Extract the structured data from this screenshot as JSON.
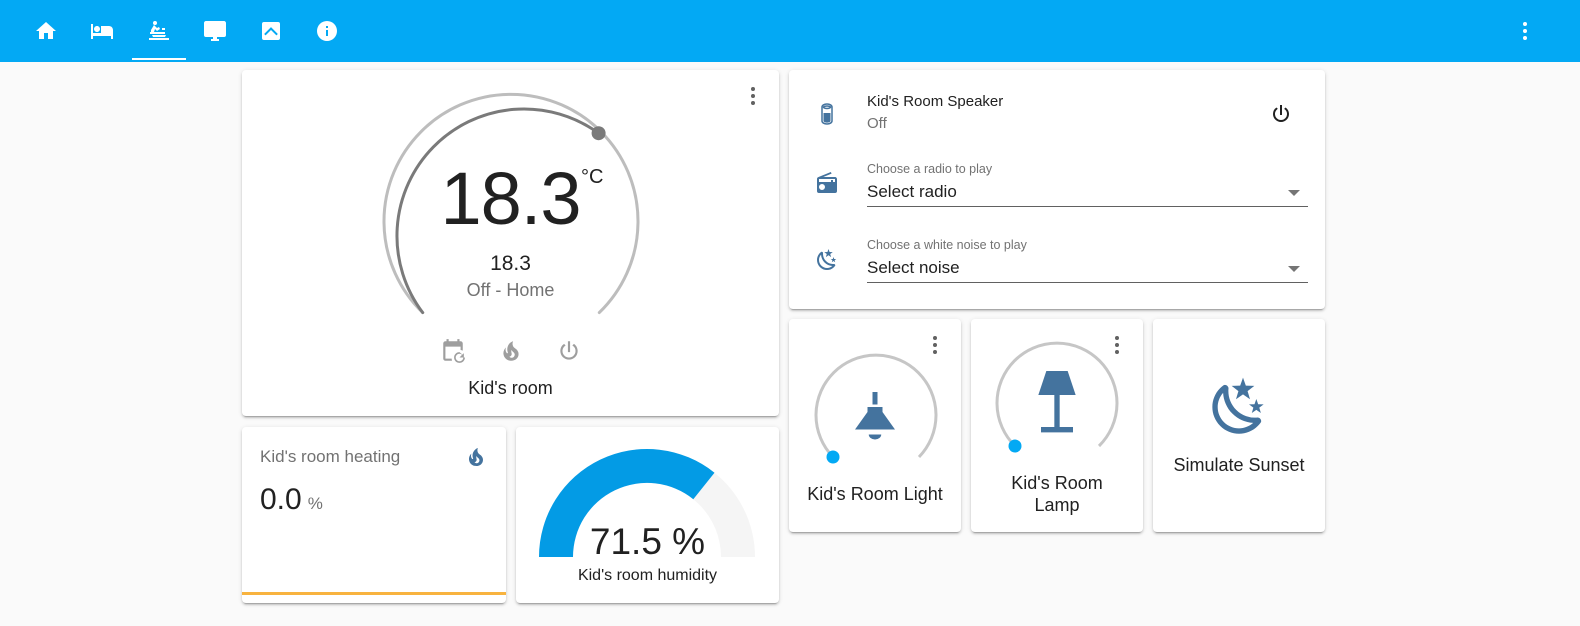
{
  "header": {
    "tabs": [
      {
        "name": "home",
        "icon": "home-icon"
      },
      {
        "name": "bedroom",
        "icon": "bed-icon"
      },
      {
        "name": "kids-room",
        "icon": "baby-bath-icon",
        "active": true
      },
      {
        "name": "monitor",
        "icon": "monitor-icon"
      },
      {
        "name": "chevron-up-box",
        "icon": "chevron-up-box-icon"
      },
      {
        "name": "info",
        "icon": "information-icon"
      }
    ],
    "accent": "#03a9f4"
  },
  "thermostat": {
    "target_temp": "18.3",
    "unit": "°C",
    "current_temp": "18.3",
    "status": "Off - Home",
    "name": "Kid's room",
    "modes": [
      "calendar-sync-icon",
      "fire-icon",
      "power-icon"
    ]
  },
  "heating_sensor": {
    "name": "Kid's room heating",
    "value": "0.0",
    "unit": "%",
    "icon": "fire-icon"
  },
  "humidity_gauge": {
    "value_text": "71.5 %",
    "value": 71.5,
    "max": 100,
    "name": "Kid's room humidity",
    "color": "#039be5"
  },
  "entities": {
    "speaker": {
      "title": "Kid's Room Speaker",
      "state": "Off",
      "icon": "speaker-icon"
    },
    "radio": {
      "label": "Choose a radio to play",
      "value": "Select radio",
      "icon": "radio-icon"
    },
    "noise": {
      "label": "Choose a white noise to play",
      "value": "Select noise",
      "icon": "weather-night-icon"
    }
  },
  "lights": [
    {
      "name": "Kid's Room Light",
      "icon": "ceiling-light-icon"
    },
    {
      "name_line1": "Kid's Room",
      "name_line2": "Lamp",
      "icon": "floor-lamp-icon"
    }
  ],
  "scene": {
    "name": "Simulate Sunset",
    "icon": "weather-night-icon"
  },
  "colors": {
    "icon": "#44739e",
    "slider": "#03a9f4",
    "heating_bar": "#f8b33f"
  }
}
